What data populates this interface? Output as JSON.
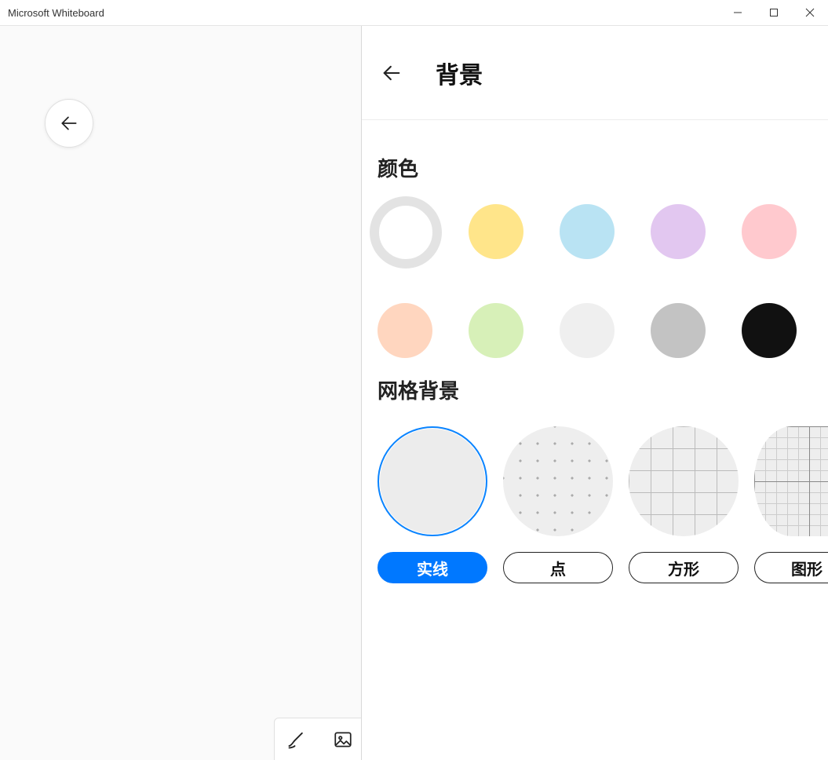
{
  "window": {
    "title": "Microsoft Whiteboard"
  },
  "panel": {
    "title": "背景",
    "color_section_title": "颜色",
    "grid_section_title": "网格背景",
    "colors": {
      "c0": "#ffffff",
      "c1": "#ffe58a",
      "c2": "#b9e3f3",
      "c3": "#e2c7f0",
      "c4": "#ffc9ce",
      "c5": "#ffd6bf",
      "c6": "#d7f0b8",
      "c7": "#efefef",
      "c8": "#c3c3c3",
      "c9": "#111111"
    },
    "selected_color_index": 0,
    "grids": {
      "g0": "实线",
      "g1": "点",
      "g2": "方形",
      "g3": "图形"
    },
    "selected_grid_index": 0
  },
  "toolbar": {
    "pen": "pen",
    "image": "image"
  }
}
